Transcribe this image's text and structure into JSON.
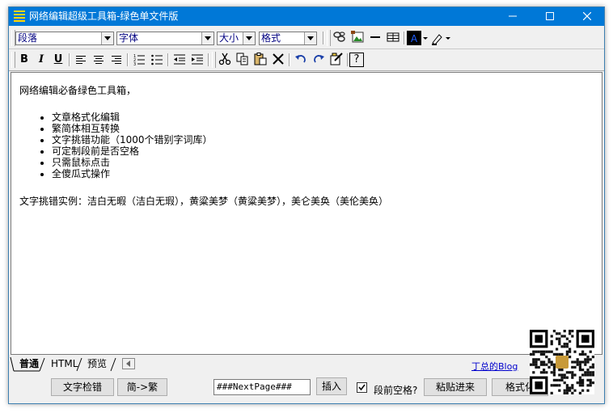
{
  "window": {
    "title": "网络编辑超级工具箱-绿色单文件版",
    "minimize_icon": "minimize-icon",
    "maximize_icon": "maximize-icon",
    "close_icon": "close-icon"
  },
  "toolbar1": {
    "paragraph_select": "段落",
    "font_select": "字体",
    "size_select": "大小",
    "format_select": "格式"
  },
  "toolbar2": {
    "bold": "B",
    "italic": "I",
    "underline": "U"
  },
  "editor": {
    "intro": "网络编辑必备绿色工具箱，",
    "features": [
      "文章格式化编辑",
      "繁简体相互转换",
      "文字挑错功能（1000个错别字词库）",
      "可定制段前是否空格",
      "只需鼠标点击",
      "全傻瓜式操作"
    ],
    "example": "文字挑错实例：洁白无暇（洁白无瑕），黄粱美梦（黄粱美梦），美仑美奂（美伦美奂）"
  },
  "tabs": {
    "normal": "普通",
    "html": "HTML",
    "preview": "预览",
    "blog_link": "丁总的Blog"
  },
  "bottom": {
    "check_text_button": "文字检错",
    "convert_button": "简->繁",
    "page_break_value": "###NextPage###",
    "insert_button": "插入",
    "indent_checkbox_label": "段前空格?",
    "indent_checked": true,
    "paste_button": "粘贴进来",
    "format_button": "格式化"
  }
}
